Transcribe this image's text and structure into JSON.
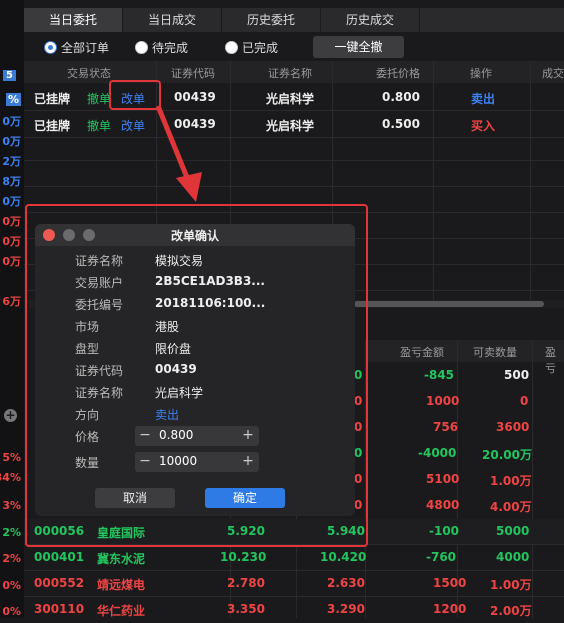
{
  "left_values": [
    "5",
    "%",
    "0万",
    "0万",
    "2万",
    "8万",
    "0万",
    "0万",
    "0万",
    "0万",
    "6万",
    "5%",
    "34%",
    "3%",
    "2%",
    "2%",
    "0%",
    "0%"
  ],
  "tabs": [
    "当日委托",
    "当日成交",
    "历史委托",
    "历史成交"
  ],
  "filters": {
    "all": "全部订单",
    "pending": "待完成",
    "done": "已完成",
    "cancel_all": "一键全撤"
  },
  "orders_header": [
    "交易状态",
    "证券代码",
    "证券名称",
    "委托价格",
    "操作",
    "成交"
  ],
  "orders": [
    {
      "status": "已挂牌",
      "cancel": "撤单",
      "modify": "改单",
      "code": "00439",
      "name": "光启科学",
      "price": "0.800",
      "action": "卖出"
    },
    {
      "status": "已挂牌",
      "cancel": "撤单",
      "modify": "改单",
      "code": "00439",
      "name": "光启科学",
      "price": "0.500",
      "action": "买入"
    }
  ],
  "holdings_header": [
    "盈亏金额",
    "可卖数量",
    "盈亏"
  ],
  "holdings_partial": [
    {
      "c4": "0",
      "pl": "-845",
      "qty": "500"
    },
    {
      "c4": "0",
      "pl": "1000",
      "qty": "0"
    },
    {
      "c4": "0",
      "pl": "756",
      "qty": "3600"
    },
    {
      "c4": "0",
      "pl": "-4000",
      "qty": "20.00万"
    },
    {
      "c4": "0",
      "pl": "5100",
      "qty": "1.00万"
    },
    {
      "c4": "0",
      "pl": "4800",
      "qty": "4.00万"
    }
  ],
  "holdings": [
    {
      "code": "000056",
      "name": "皇庭国际",
      "cost": "5.920",
      "price": "5.940",
      "pl": "-100",
      "qty": "5000"
    },
    {
      "code": "000401",
      "name": "冀东水泥",
      "cost": "10.230",
      "price": "10.420",
      "pl": "-760",
      "qty": "4000"
    },
    {
      "code": "000552",
      "name": "靖远煤电",
      "cost": "2.780",
      "price": "2.630",
      "pl": "1500",
      "qty": "1.00万"
    },
    {
      "code": "300110",
      "name": "华仁药业",
      "cost": "3.350",
      "price": "3.290",
      "pl": "1200",
      "qty": "2.00万"
    }
  ],
  "dialog": {
    "title": "改单确认",
    "rows": [
      {
        "label": "证券名称",
        "value": "模拟交易"
      },
      {
        "label": "交易账户",
        "value": "2B5CE1AD3B3..."
      },
      {
        "label": "委托编号",
        "value": "20181106:100..."
      },
      {
        "label": "市场",
        "value": "港股"
      },
      {
        "label": "盘型",
        "value": "限价盘"
      },
      {
        "label": "证券代码",
        "value": "00439"
      },
      {
        "label": "证券名称",
        "value": "光启科学"
      },
      {
        "label": "方向",
        "value": "卖出"
      }
    ],
    "price_label": "价格",
    "price": "0.800",
    "qty_label": "数量",
    "qty": "10000",
    "cancel": "取消",
    "confirm": "确定"
  },
  "colors": {
    "up": "#ef4444",
    "down": "#22c55e",
    "accent": "#3a7bd5",
    "highlight": "#e0363a"
  }
}
